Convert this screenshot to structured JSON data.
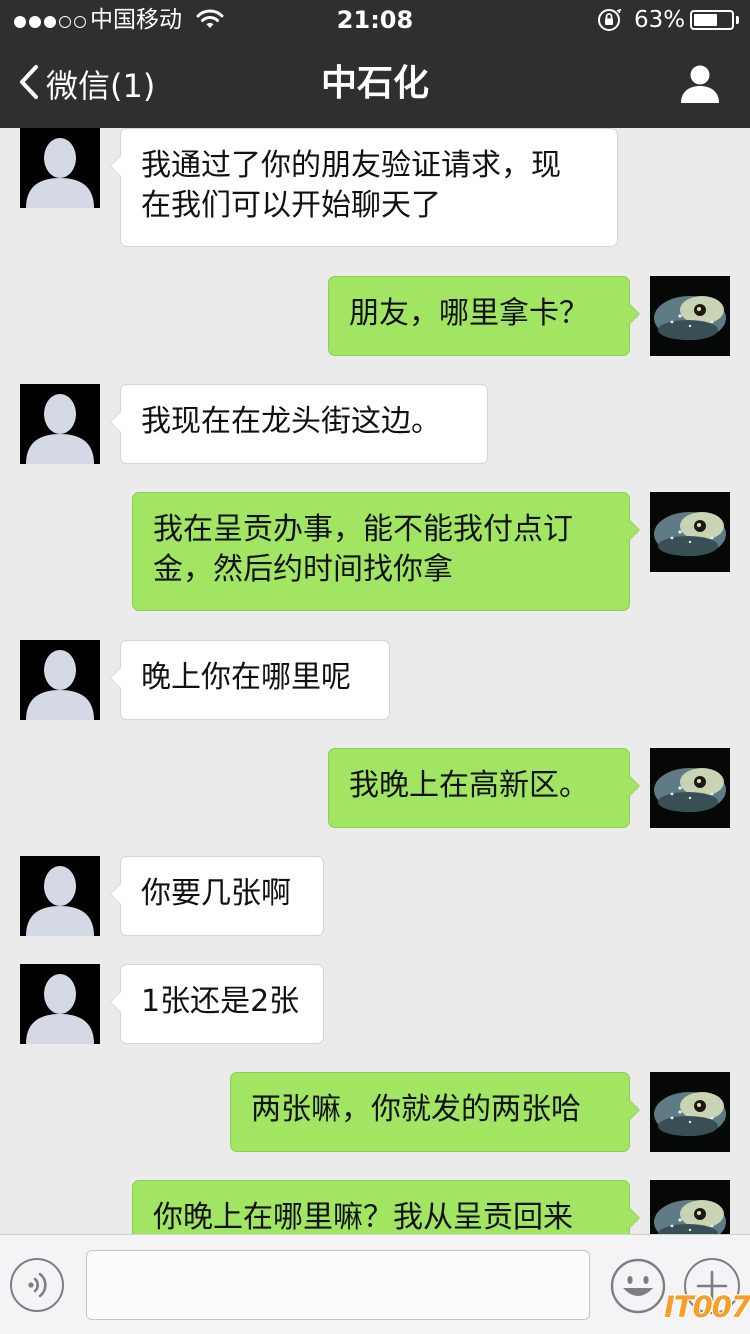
{
  "status_bar": {
    "carrier": "中国移动",
    "time": "21:08",
    "battery_percent_text": "63%",
    "battery_level": 0.63,
    "signal_bars_filled": 3,
    "signal_bars_total": 5
  },
  "nav": {
    "back_label": "微信(1)",
    "title": "中石化"
  },
  "colors": {
    "nav_bg": "#2f2f31",
    "chat_bg": "#ebebeb",
    "incoming_bubble": "#ffffff",
    "outgoing_bubble": "#a2e563",
    "watermark": "#f6a02b"
  },
  "messages": [
    {
      "direction": "in",
      "lines": [
        "我通过了你的朋友验证请求，现",
        "在我们可以开始聊天了"
      ]
    },
    {
      "direction": "out",
      "lines": [
        "朋友，哪里拿卡？"
      ]
    },
    {
      "direction": "in",
      "lines": [
        "我现在在龙头街这边。"
      ]
    },
    {
      "direction": "out",
      "lines": [
        "我在呈贡办事，能不能我付点订",
        "金，然后约时间找你拿"
      ]
    },
    {
      "direction": "in",
      "lines": [
        "晚上你在哪里呢"
      ]
    },
    {
      "direction": "out",
      "lines": [
        "我晚上在高新区。"
      ]
    },
    {
      "direction": "in",
      "lines": [
        "你要几张啊"
      ]
    },
    {
      "direction": "in",
      "lines": [
        "1张还是2张"
      ]
    },
    {
      "direction": "out",
      "lines": [
        "两张嘛，你就发的两张哈"
      ]
    },
    {
      "direction": "out",
      "lines": [
        "你晚上在哪里嘛？我从呈贡回来"
      ]
    }
  ],
  "icons": {
    "incoming_avatar": "default-person-avatar",
    "outgoing_avatar": "fish-photo-avatar",
    "contact": "person-icon",
    "voice": "voice-icon",
    "emoji": "emoji-icon",
    "plus": "plus-icon"
  },
  "input": {
    "value": "",
    "placeholder": ""
  },
  "watermark_text": "IT007"
}
